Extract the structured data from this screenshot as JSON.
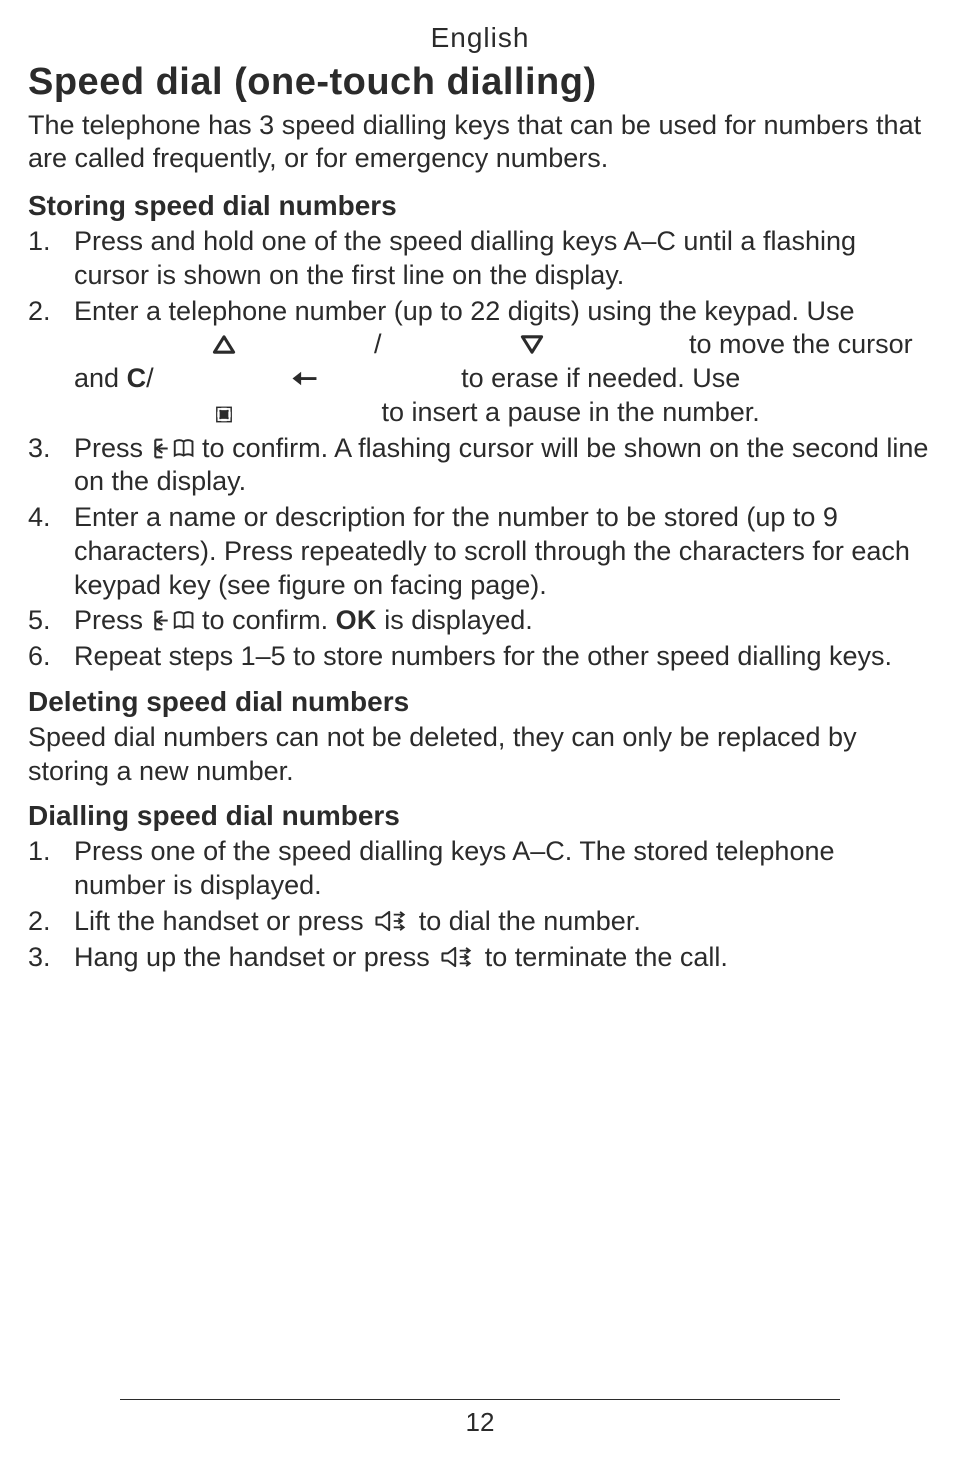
{
  "language": "English",
  "title": "Speed dial (one-touch dialling)",
  "intro": "The telephone has 3 speed dialling keys that can be used for numbers that are called frequently, or for emergency numbers.",
  "sections": {
    "store": {
      "heading": "Storing speed dial numbers",
      "steps": [
        {
          "a": "Press and hold one of the speed dialling keys A–C until a flashing cursor is shown on the first line on the display."
        },
        {
          "a": "Enter a telephone number (up to 22 digits) using the keypad. Use ",
          "b": " to move the cursor and ",
          "c": " to erase if needed. Use ",
          "d": " to insert a pause in the number."
        },
        {
          "a": "Press ",
          "b": " to confirm. A flashing cursor will be shown on the second line on the display."
        },
        {
          "a": "Enter a name or description for the number to be stored (up to 9 characters). Press repeatedly to scroll through the characters for each keypad key (see figure on facing page)."
        },
        {
          "a": "Press ",
          "b": " to confirm. ",
          "ok": "OK",
          "c": " is displayed."
        },
        {
          "a": "Repeat steps 1–5 to store numbers for the other speed dialling keys."
        }
      ]
    },
    "delete": {
      "heading": "Deleting speed dial numbers",
      "body": "Speed dial numbers can not be deleted, they can only be replaced by storing a new number."
    },
    "dial": {
      "heading": "Dialling speed dial numbers",
      "steps": [
        {
          "a": "Press one of the speed dialling keys A–C. The stored telephone number is displayed."
        },
        {
          "a": "Lift the handset or press ",
          "b": " to dial the number."
        },
        {
          "a": "Hang up the handset or press ",
          "b": " to terminate the call."
        }
      ]
    }
  },
  "erase_key": "C",
  "pageNumber": "12"
}
